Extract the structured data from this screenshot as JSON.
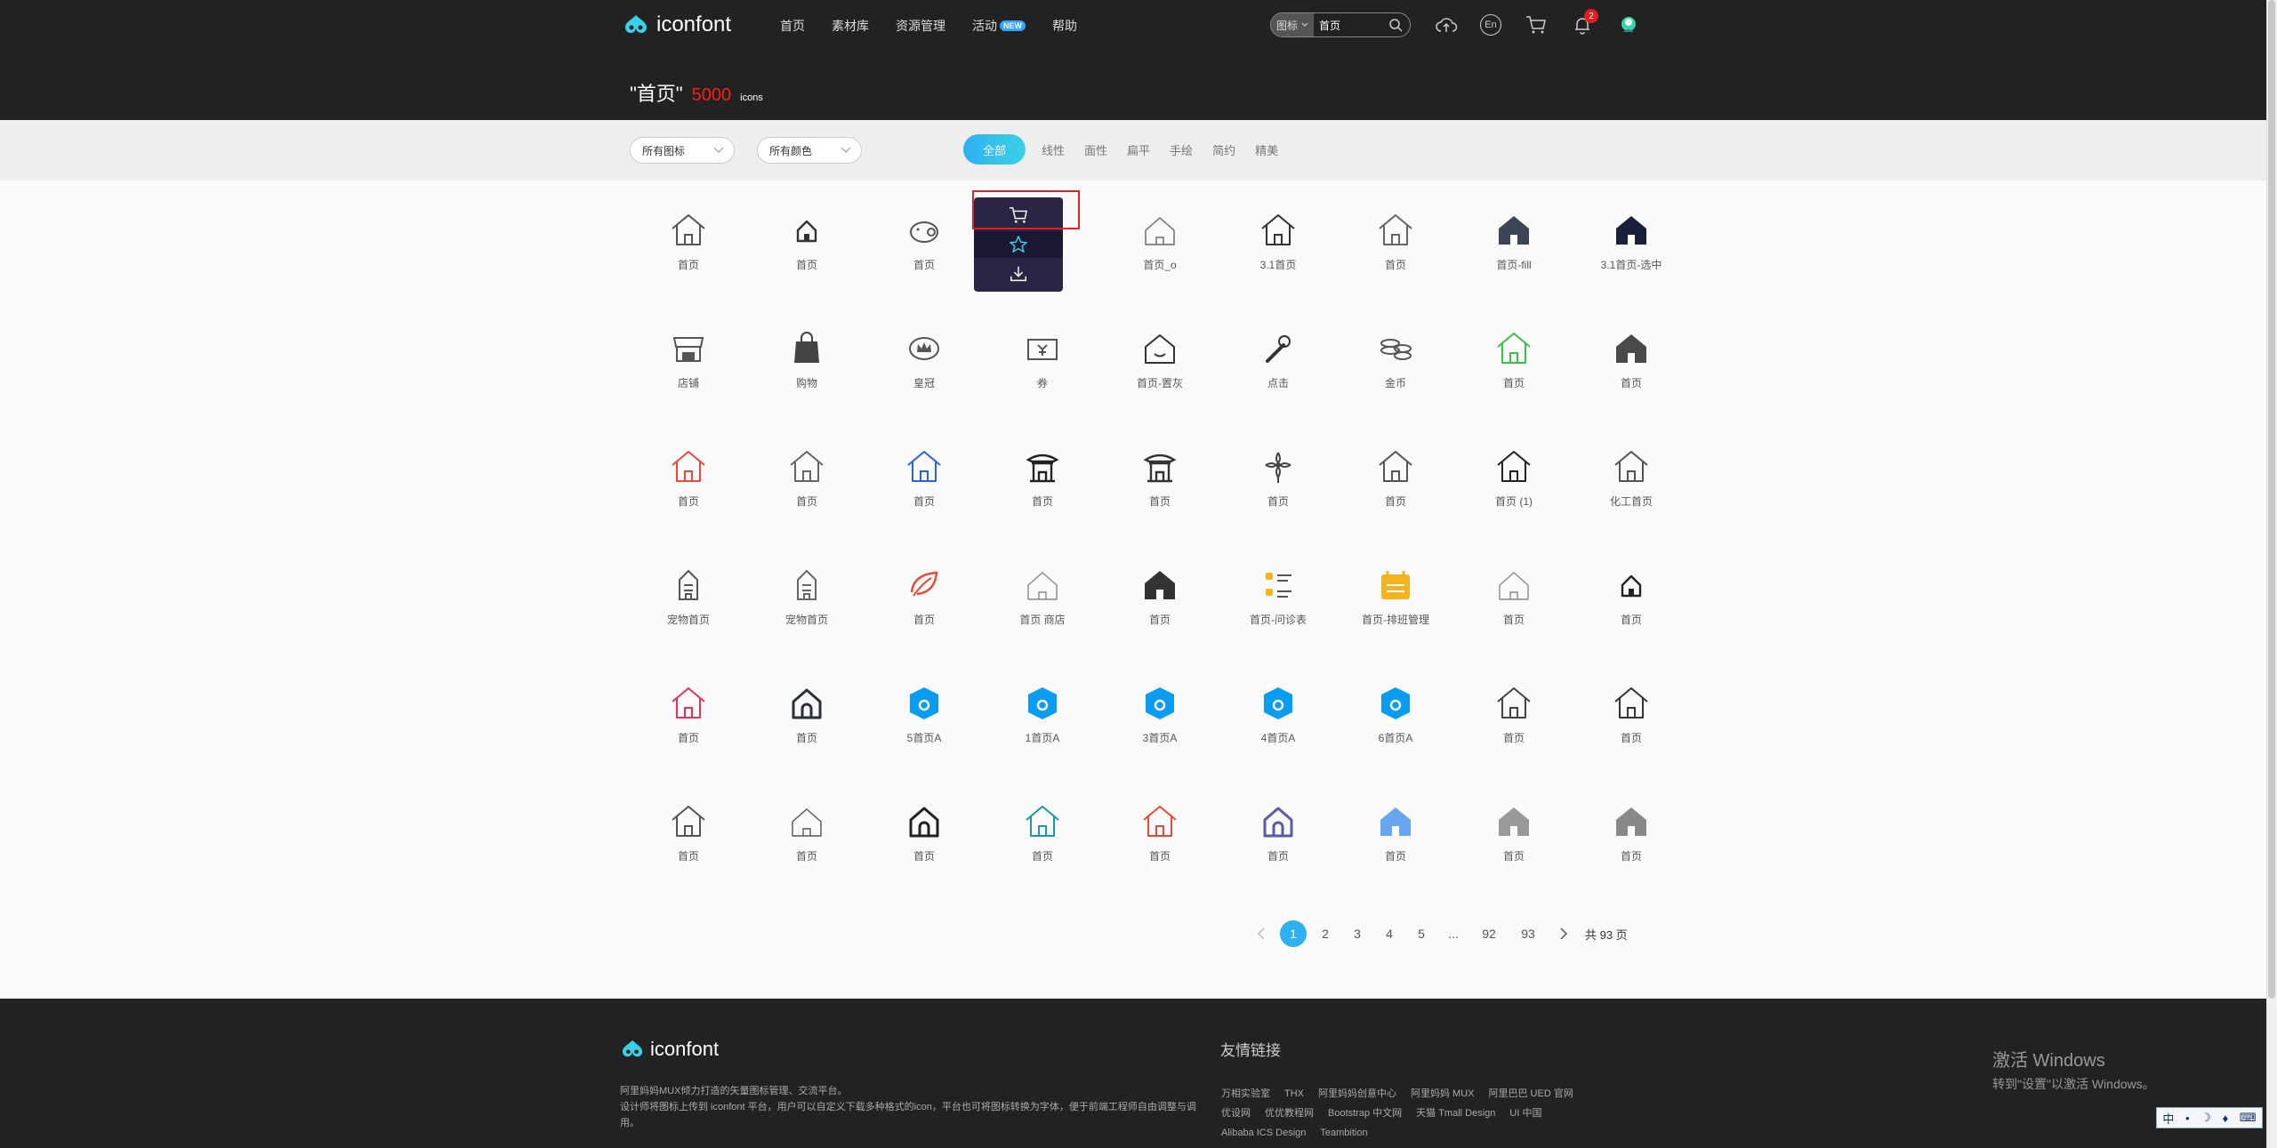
{
  "header": {
    "logo_text": "iconfont",
    "nav": [
      "首页",
      "素材库",
      "资源管理",
      "活动",
      "帮助"
    ],
    "new_badge": "NEW",
    "search": {
      "type": "图标",
      "value": "首页"
    },
    "lang": "En",
    "notification_count": "2"
  },
  "title": {
    "query": "\"首页\"",
    "count": "5000",
    "unit": "icons"
  },
  "filters": {
    "icon_select": "所有图标",
    "color_select": "所有颜色",
    "style_tabs": [
      "全部",
      "线性",
      "面性",
      "扁平",
      "手绘",
      "简约",
      "精美"
    ]
  },
  "icons": [
    {
      "label": "首页",
      "glyph": "house-outline",
      "color": "#555555"
    },
    {
      "label": "首页",
      "glyph": "house-small",
      "color": "#333333"
    },
    {
      "label": "首页",
      "glyph": "pig",
      "color": "#555555"
    },
    {
      "label": "",
      "glyph": "hovered",
      "color": "#333333"
    },
    {
      "label": "首页_o",
      "glyph": "house-thin",
      "color": "#666666"
    },
    {
      "label": "3.1首页",
      "glyph": "house-outline",
      "color": "#333333"
    },
    {
      "label": "首页",
      "glyph": "house-outline",
      "color": "#666666"
    },
    {
      "label": "首页-fill",
      "glyph": "house-fill",
      "color": "#3a4555"
    },
    {
      "label": "3.1首页-选中",
      "glyph": "house-fill",
      "color": "#1a1f3a"
    },
    {
      "label": "店铺",
      "glyph": "shop",
      "color": "#555555"
    },
    {
      "label": "购物",
      "glyph": "bag",
      "color": "#444444"
    },
    {
      "label": "皇冠",
      "glyph": "crown",
      "color": "#555555"
    },
    {
      "label": "券",
      "glyph": "ticket",
      "color": "#555555"
    },
    {
      "label": "首页-置灰",
      "glyph": "house-smile",
      "color": "#333333"
    },
    {
      "label": "点击",
      "glyph": "click",
      "color": "#333333"
    },
    {
      "label": "金币",
      "glyph": "coins",
      "color": "#555555"
    },
    {
      "label": "首页",
      "glyph": "house-outline",
      "color": "#3cbf4a"
    },
    {
      "label": "首页",
      "glyph": "house-fill",
      "color": "#4a4a4a"
    },
    {
      "label": "首页",
      "glyph": "house-outline",
      "color": "#e84a3a"
    },
    {
      "label": "首页",
      "glyph": "house-outline",
      "color": "#666666"
    },
    {
      "label": "首页",
      "glyph": "house-outline",
      "color": "#2d63d8"
    },
    {
      "label": "首页",
      "glyph": "temple",
      "color": "#222222"
    },
    {
      "label": "首页",
      "glyph": "temple",
      "color": "#333333"
    },
    {
      "label": "首页",
      "glyph": "flower",
      "color": "#444444"
    },
    {
      "label": "首页",
      "glyph": "house-outline",
      "color": "#555555"
    },
    {
      "label": "首页 (1)",
      "glyph": "house-outline",
      "color": "#222222"
    },
    {
      "label": "化工首页",
      "glyph": "house-outline",
      "color": "#555555"
    },
    {
      "label": "宠物首页",
      "glyph": "tower",
      "color": "#555555"
    },
    {
      "label": "宠物首页",
      "glyph": "tower",
      "color": "#666666"
    },
    {
      "label": "首页",
      "glyph": "leaf",
      "color": "#e84a3a"
    },
    {
      "label": "首页 商店",
      "glyph": "house-thin",
      "color": "#888888"
    },
    {
      "label": "首页",
      "glyph": "house-fill",
      "color": "#333333"
    },
    {
      "label": "首页-问诊表",
      "glyph": "list",
      "color": "#f5b31e"
    },
    {
      "label": "首页-排班管理",
      "glyph": "calendar",
      "color": "#f5b31e"
    },
    {
      "label": "首页",
      "glyph": "house-thin",
      "color": "#888888"
    },
    {
      "label": "首页",
      "glyph": "house-small",
      "color": "#222222"
    },
    {
      "label": "首页",
      "glyph": "house-outline",
      "color": "#e8325a"
    },
    {
      "label": "首页",
      "glyph": "house-thick",
      "color": "#2a2f3e"
    },
    {
      "label": "5首页A",
      "glyph": "hex-badge",
      "color": "#0a9cf0"
    },
    {
      "label": "1首页A",
      "glyph": "hex-badge",
      "color": "#0a9cf0"
    },
    {
      "label": "3首页A",
      "glyph": "hex-badge",
      "color": "#0a9cf0"
    },
    {
      "label": "4首页A",
      "glyph": "hex-badge",
      "color": "#0a9cf0"
    },
    {
      "label": "6首页A",
      "glyph": "hex-badge",
      "color": "#0a9cf0"
    },
    {
      "label": "首页",
      "glyph": "house-outline",
      "color": "#444444"
    },
    {
      "label": "首页",
      "glyph": "house-outline",
      "color": "#333333"
    },
    {
      "label": "首页",
      "glyph": "house-outline",
      "color": "#555555"
    },
    {
      "label": "首页",
      "glyph": "house-thin",
      "color": "#555555"
    },
    {
      "label": "首页",
      "glyph": "house-thick",
      "color": "#222222"
    },
    {
      "label": "首页",
      "glyph": "house-outline",
      "color": "#1a9aa0"
    },
    {
      "label": "首页",
      "glyph": "house-outline",
      "color": "#e84a3a"
    },
    {
      "label": "首页",
      "glyph": "house-thick",
      "color": "#5a5aa8"
    },
    {
      "label": "首页",
      "glyph": "house-fill",
      "color": "#6aa6f0"
    },
    {
      "label": "首页",
      "glyph": "house-fill",
      "color": "#999999"
    },
    {
      "label": "首页",
      "glyph": "house-fill",
      "color": "#888888"
    }
  ],
  "hover_menu": [
    "cart-icon",
    "star-icon",
    "download-icon"
  ],
  "pagination": {
    "pages": [
      "1",
      "2",
      "3",
      "4",
      "5",
      "...",
      "92",
      "93"
    ],
    "current": "1",
    "total": "共 93 页"
  },
  "footer": {
    "logo_text": "iconfont",
    "desc1": "阿里妈妈MUX倾力打造的矢量图标管理、交流平台。",
    "desc2": "设计师将图标上传到 iconfont 平台，用户可以自定义下载多种格式的icon，平台也可将图标转换为字体，便于前端工程师自由调整与调用。",
    "links_title": "友情链接",
    "links": [
      "万相实验室",
      "THX",
      "阿里妈妈创意中心",
      "阿里妈妈 MUX",
      "阿里巴巴 UED 官网",
      "优设网",
      "优优教程网",
      "Bootstrap 中文网",
      "天猫 Tmall Design",
      "UI 中国",
      "Alibaba ICS Design",
      "Teambition"
    ]
  },
  "windows": {
    "line1": "激活 Windows",
    "line2": "转到\"设置\"以激活 Windows。"
  },
  "ime": [
    "中",
    "•",
    "☽",
    "♦",
    "⌨"
  ]
}
